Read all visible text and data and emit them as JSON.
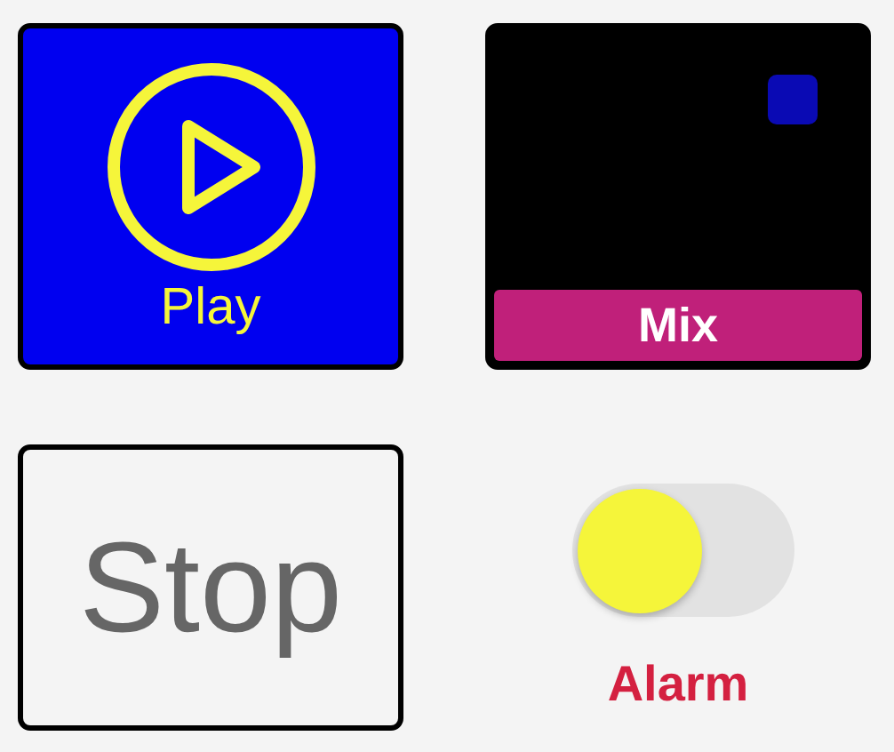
{
  "tiles": [
    {
      "kind": "play",
      "label": "Play"
    },
    {
      "kind": "mix",
      "label": "Mix"
    },
    {
      "kind": "stop",
      "label": "Stop"
    },
    {
      "kind": "toggle",
      "label": "Alarm",
      "on": false
    }
  ]
}
